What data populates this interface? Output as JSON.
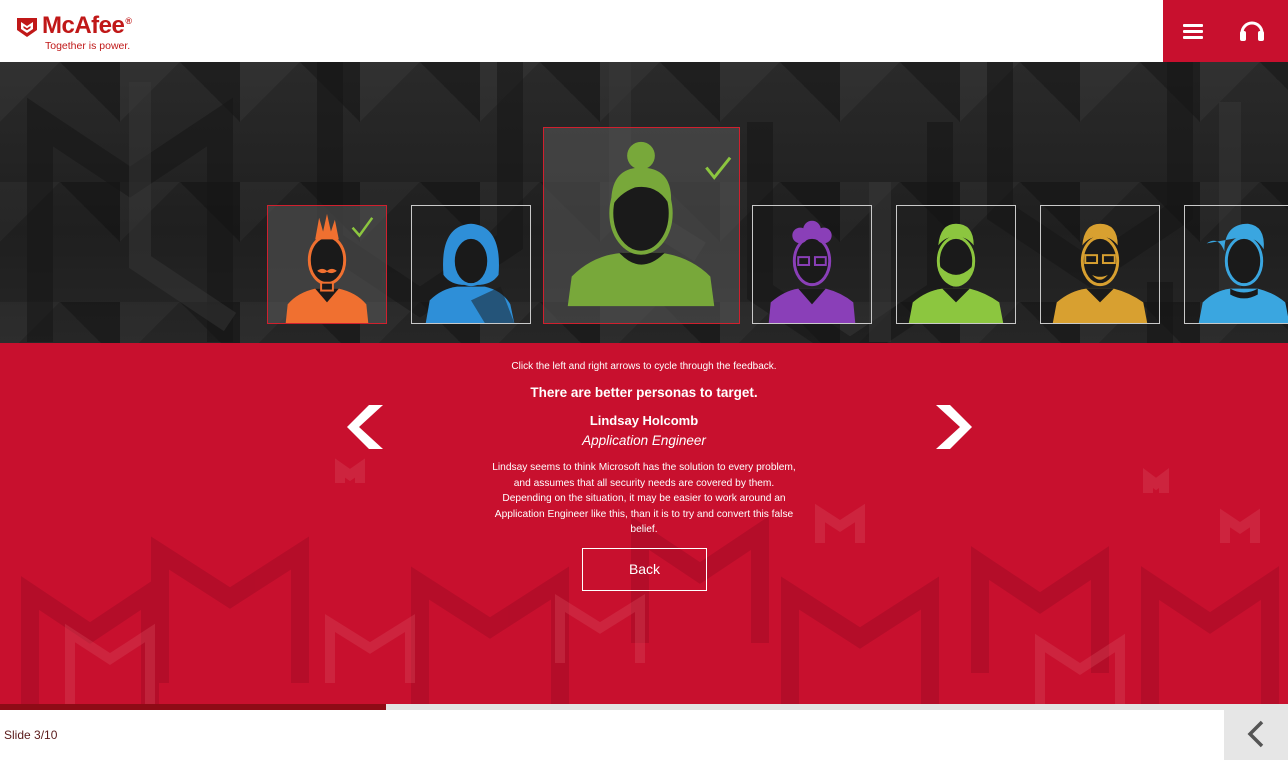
{
  "brand": {
    "name": "McAfee",
    "tagline": "Together is power.",
    "color": "#c8102e"
  },
  "header": {
    "menu_icon": "hamburger-menu-icon",
    "support_icon": "headset-icon"
  },
  "personas": [
    {
      "id": "persona-1",
      "color": "#f07030",
      "selected": true,
      "style": "mohawk-mustache"
    },
    {
      "id": "persona-2",
      "color": "#2e8fd8",
      "selected": false,
      "style": "bob-hair"
    },
    {
      "id": "persona-3",
      "color": "#78a83a",
      "selected": true,
      "featured": true,
      "style": "bun-hair"
    },
    {
      "id": "persona-4",
      "color": "#8a3fb8",
      "selected": false,
      "style": "curly-glasses"
    },
    {
      "id": "persona-5",
      "color": "#8cc63f",
      "selected": false,
      "style": "beard"
    },
    {
      "id": "persona-6",
      "color": "#d8a030",
      "selected": false,
      "style": "glasses-beard"
    },
    {
      "id": "persona-7",
      "color": "#3aa6e0",
      "selected": false,
      "style": "side-swept"
    }
  ],
  "feedback": {
    "instructions": "Click the left and right arrows to cycle through the feedback.",
    "headline": "There are better personas to target.",
    "name": "Lindsay Holcomb",
    "role": "Application Engineer",
    "body": "Lindsay seems to think Microsoft has the solution to every problem, and assumes that  all security needs are covered by them. Depending on the situation, it may be easier to work around an Application Engineer like this, than it is to try and convert this false belief.",
    "back_label": "Back"
  },
  "progress": {
    "fraction": 0.3
  },
  "footer": {
    "slide_label": "Slide 3/10"
  }
}
